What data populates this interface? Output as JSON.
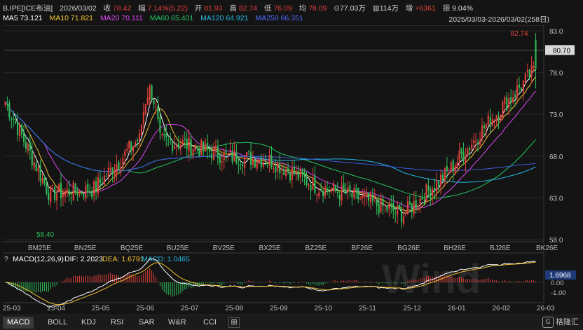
{
  "header": {
    "symbol": "B.IPE[ICE布油]",
    "date": "2026/03/02",
    "close_label": "收",
    "close": "78.42",
    "change_label": "幅",
    "change": "7.14%(5.22)",
    "open_label": "开",
    "open": "81.93",
    "high_label": "高",
    "high": "82.74",
    "low_label": "低",
    "low": "76.09",
    "avg_label": "均",
    "avg": "78.09",
    "amount": "77.03万",
    "volume": "114万",
    "oi_label": "增",
    "oi": "+6361",
    "amp_label": "振",
    "amp": "9.04%"
  },
  "ma": {
    "ma5": "MA5 73.121",
    "ma10": "MA10 71.821",
    "ma20": "MA20 70.111",
    "ma60": "MA60 65.401",
    "ma120": "MA120 64.921",
    "ma250": "MA250 66.351"
  },
  "date_range": "2025/03/03-2026/03/02(258日)",
  "price_axis": {
    "ticks": [
      "83.0",
      "78.0",
      "73.0",
      "68.0",
      "63.0",
      "58.0"
    ],
    "current_tag": "80.70",
    "high_mark": "82.74",
    "low_mark": "58.40"
  },
  "contract_labels": [
    "BM25E",
    "BN25E",
    "BQ25E",
    "BU25E",
    "BV25E",
    "BX25E",
    "BZ25E",
    "BF26E",
    "BG26E",
    "BH26E",
    "BJ26E",
    "BK26E"
  ],
  "macd": {
    "title": "MACD(12,26,9)",
    "dif_text": "DIF: 2.2023",
    "dea_text": "DEA: 1.6791",
    "macd_text": "MACD: 1.0465",
    "axis_ticks": [
      "1.00",
      "0.00",
      "-1.00"
    ],
    "current_tag": "1.6968"
  },
  "time_axis": [
    "25-03",
    "25-04",
    "25-05",
    "25-06",
    "25-07",
    "25-08",
    "25-09",
    "25-10",
    "25-11",
    "25-12",
    "26-01",
    "26-02",
    "26-03"
  ],
  "tabs": [
    "MACD",
    "BOLL",
    "KDJ",
    "RSI",
    "SAR",
    "W&R",
    "CCI"
  ],
  "brand": "格隆汇",
  "watermark": "Wind",
  "colors": {
    "up": "#e0403a",
    "down": "#2fbf5a",
    "ma5": "#ffffff",
    "ma10": "#f2c230",
    "ma20": "#d946ef",
    "ma60": "#22c55e",
    "ma120": "#22b8e6",
    "ma250": "#3b5bdb"
  },
  "chart_data": {
    "type": "candlestick",
    "title": "B.IPE[ICE布油]",
    "period": "2025/03/03-2026/03/02",
    "ylim": [
      58,
      83.5
    ],
    "last_close": 78.42,
    "high": 82.74,
    "low": 58.4,
    "ma_values": {
      "MA5": 73.121,
      "MA10": 71.821,
      "MA20": 70.111,
      "MA60": 65.401,
      "MA120": 64.921,
      "MA250": 66.351
    },
    "monthly_close": {
      "categories": [
        "25-03",
        "25-04",
        "25-05",
        "25-06",
        "25-07",
        "25-08",
        "25-09",
        "25-10",
        "25-11",
        "25-12",
        "26-01",
        "26-02",
        "26-03"
      ],
      "values": [
        74.5,
        63.5,
        64.0,
        70.0,
        69.5,
        68.0,
        67.5,
        64.5,
        63.0,
        61.0,
        66.0,
        72.5,
        78.42
      ]
    },
    "macd": {
      "DIF": 2.2023,
      "DEA": 1.6791,
      "MACD": 1.0465
    }
  }
}
